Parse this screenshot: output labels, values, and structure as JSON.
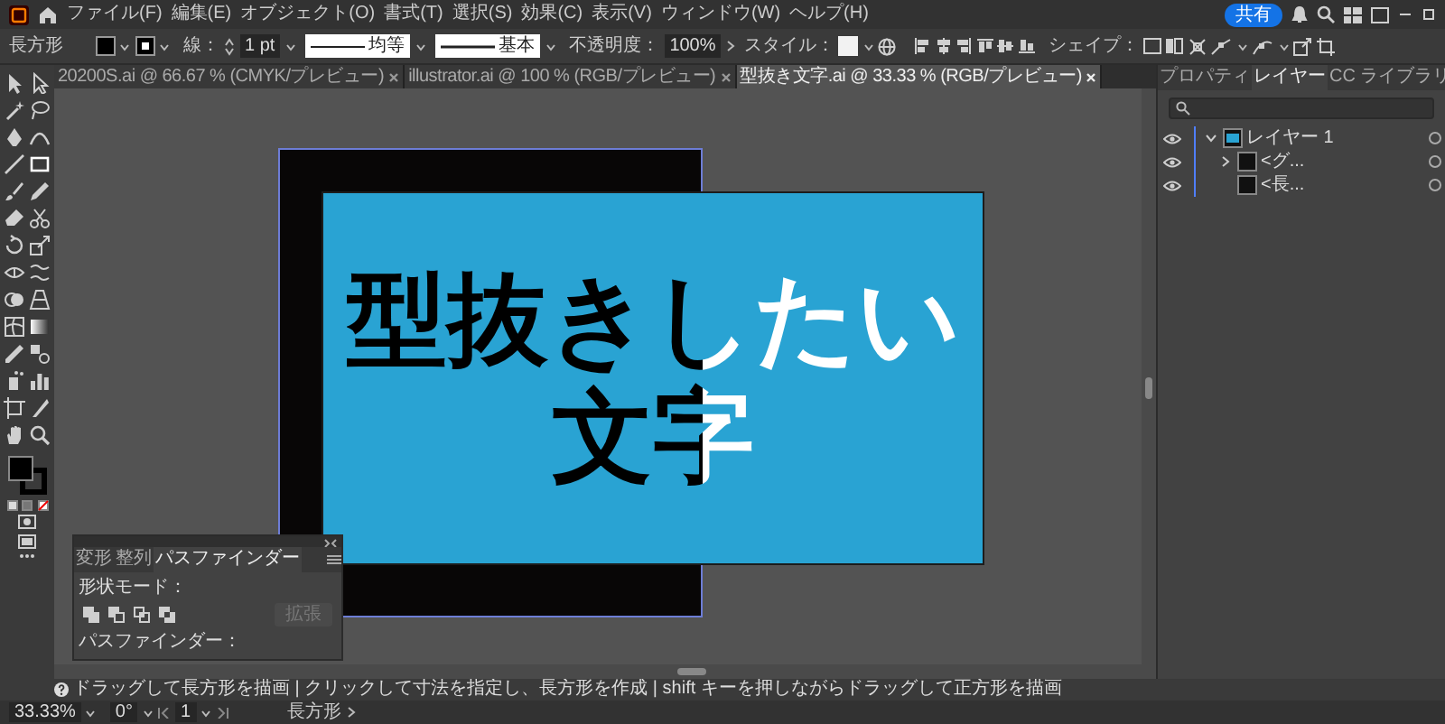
{
  "menu_bar": {
    "items": [
      "ファイル(F)",
      "編集(E)",
      "オブジェクト(O)",
      "書式(T)",
      "選択(S)",
      "効果(C)",
      "表示(V)",
      "ウィンドウ(W)",
      "ヘルプ(H)"
    ],
    "share_button": "共有"
  },
  "control_bar": {
    "tool_name": "長方形",
    "stroke_label": "線：",
    "stroke_weight": "1 pt",
    "width_profile": "均等",
    "brush": "基本",
    "opacity_label": "不透明度：",
    "opacity": "100%",
    "style_label": "スタイル：",
    "shape_label": "シェイプ："
  },
  "document_tabs": [
    {
      "title": "20200S.ai @ 66.67 % (CMYK/プレビュー)",
      "selected": false
    },
    {
      "title": "illustrator.ai @ 100 % (RGB/プレビュー)",
      "selected": false
    },
    {
      "title": "型抜き文字.ai @ 33.33 % (RGB/プレビュー)",
      "selected": true
    }
  ],
  "artwork": {
    "text_lines": [
      "型抜きしたい",
      "文字"
    ]
  },
  "right_panel": {
    "tabs": [
      {
        "label": "プロパティ",
        "selected": false
      },
      {
        "label": "レイヤー",
        "selected": true
      },
      {
        "label": "CC ライブラリ",
        "selected": false
      }
    ],
    "layers": [
      {
        "name": "レイヤー 1",
        "expanded": true,
        "children": [
          {
            "name": "<グ...",
            "expanded": false
          },
          {
            "name": "<長..."
          }
        ]
      }
    ]
  },
  "pathfinder_panel": {
    "tabs": [
      {
        "label": "変形",
        "selected": false
      },
      {
        "label": "整列",
        "selected": false
      },
      {
        "label": "パスファインダー",
        "selected": true
      }
    ],
    "shape_modes_label": "形状モード：",
    "expand_button": {
      "label": "拡張",
      "disabled": true
    },
    "pathfinders_label": "パスファインダー："
  },
  "status_hint": "ドラッグして長方形を描画 | クリックして寸法を指定し、長方形を作成 | shift キーを押しながらドラッグして正方形を描画",
  "status_bar": {
    "zoom": "33.33%",
    "rotation": "0°",
    "artboard": "1",
    "tool_name": "長方形"
  }
}
